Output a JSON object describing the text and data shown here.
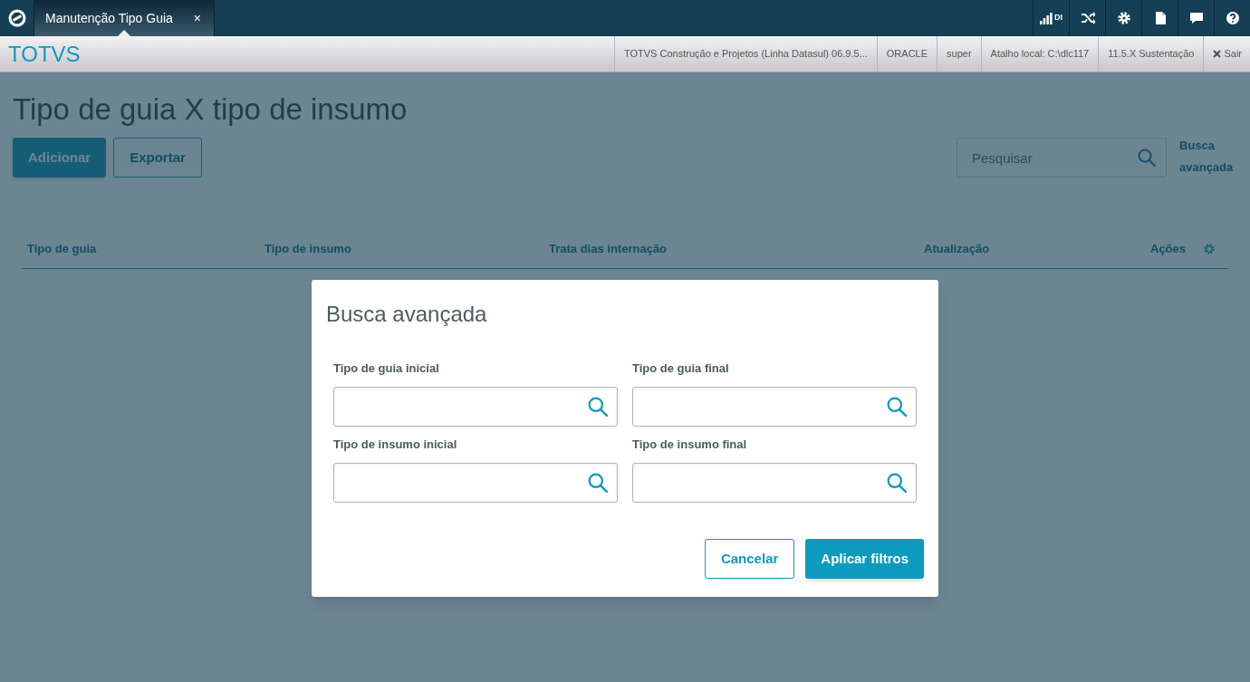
{
  "app_bar": {
    "tabs": [
      {
        "label": "Manutenção Tipo Guia",
        "close": "×",
        "selected": true
      }
    ],
    "tools": [
      {
        "kind": "signal",
        "label": "DI"
      },
      {
        "kind": "shuffle"
      },
      {
        "kind": "settings"
      },
      {
        "kind": "document"
      },
      {
        "kind": "chat"
      },
      {
        "kind": "help"
      }
    ]
  },
  "header": {
    "brand": "TOTVS",
    "info": [
      "TOTVS Construção e Projetos (Linha Datasul) 06.9.5...",
      "ORACLE",
      "super",
      "Atalho local: C:\\dlc117",
      "11.5.X Sustentação"
    ],
    "logout": "Sair"
  },
  "page": {
    "title": "Tipo de guia X tipo de insumo",
    "actions": [
      {
        "label": "Adicionar",
        "kind": "primary"
      },
      {
        "label": "Exportar",
        "kind": "secondary"
      }
    ],
    "search": {
      "placeholder": "Pesquisar"
    },
    "advanced_search_link": "Busca avançada",
    "table": {
      "columns": [
        "Tipo de guia",
        "Tipo de insumo",
        "Trata dias internação",
        "Atualização",
        "Ações"
      ]
    }
  },
  "dialog": {
    "title": "Busca avançada",
    "fields": [
      {
        "label": "Tipo de guia inicial"
      },
      {
        "label": "Tipo de guia final"
      },
      {
        "label": "Tipo de insumo inicial"
      },
      {
        "label": "Tipo de insumo final"
      }
    ],
    "buttons": [
      {
        "label": "Cancelar",
        "kind": "secondary"
      },
      {
        "label": "Aplicar filtros",
        "kind": "primary"
      }
    ]
  }
}
